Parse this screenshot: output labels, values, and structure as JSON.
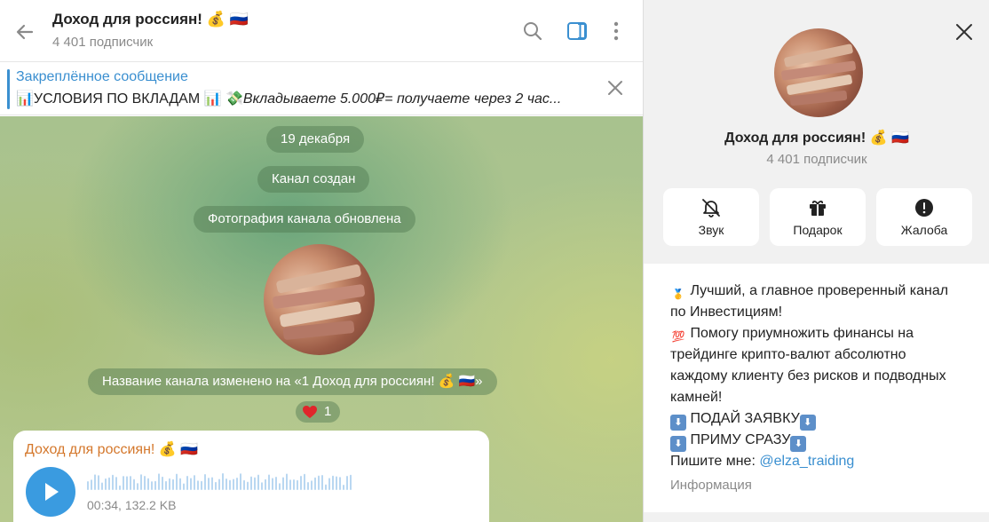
{
  "header": {
    "title": "Доход для россиян! 💰 🇷🇺",
    "subtitle": "4 401 подписчик"
  },
  "pinned": {
    "title": "Закреплённое сообщение",
    "text_main": "📊УСЛОВИЯ ПО ВКЛАДАМ 📊  💸",
    "text_italic": "Вкладываете 5.000₽= получаете через 2 час..."
  },
  "chat": {
    "service_messages": {
      "date": "19 декабря",
      "created": "Канал создан",
      "photo_updated": "Фотография канала обновлена",
      "renamed": "Название канала изменено на «1 Доход для россиян! 💰 🇷🇺»"
    },
    "reaction": {
      "emoji": "heart",
      "count": "1"
    },
    "message": {
      "author": "Доход для россиян! 💰 🇷🇺",
      "voice_meta": "00:34, 132.2 KB"
    }
  },
  "info_panel": {
    "title": "Доход для россиян! 💰 🇷🇺",
    "subtitle": "4 401 подписчик",
    "actions": [
      {
        "label": "Звук",
        "icon": "bell-off-icon"
      },
      {
        "label": "Подарок",
        "icon": "gift-icon"
      },
      {
        "label": "Жалоба",
        "icon": "alert-icon"
      }
    ],
    "description": {
      "line1": "Лучший, а главное проверенный канал",
      "line2": "по Инвестициям!",
      "line3": "Помогу приумножить финансы на",
      "line4": "трейдинге крипто-валют абсолютно",
      "line5": "каждому клиенту без рисков и подводных",
      "line6": "камней!",
      "line7": "ПОДАЙ ЗАЯВКУ",
      "line8": "ПРИМУ СРАЗУ",
      "line9_prefix": "Пишите мне: ",
      "link": "@elza_traiding"
    },
    "info_label": "Информация"
  },
  "colors": {
    "accent": "#3a8fd0",
    "author": "#d4772b",
    "play_button": "#3a9be0"
  }
}
